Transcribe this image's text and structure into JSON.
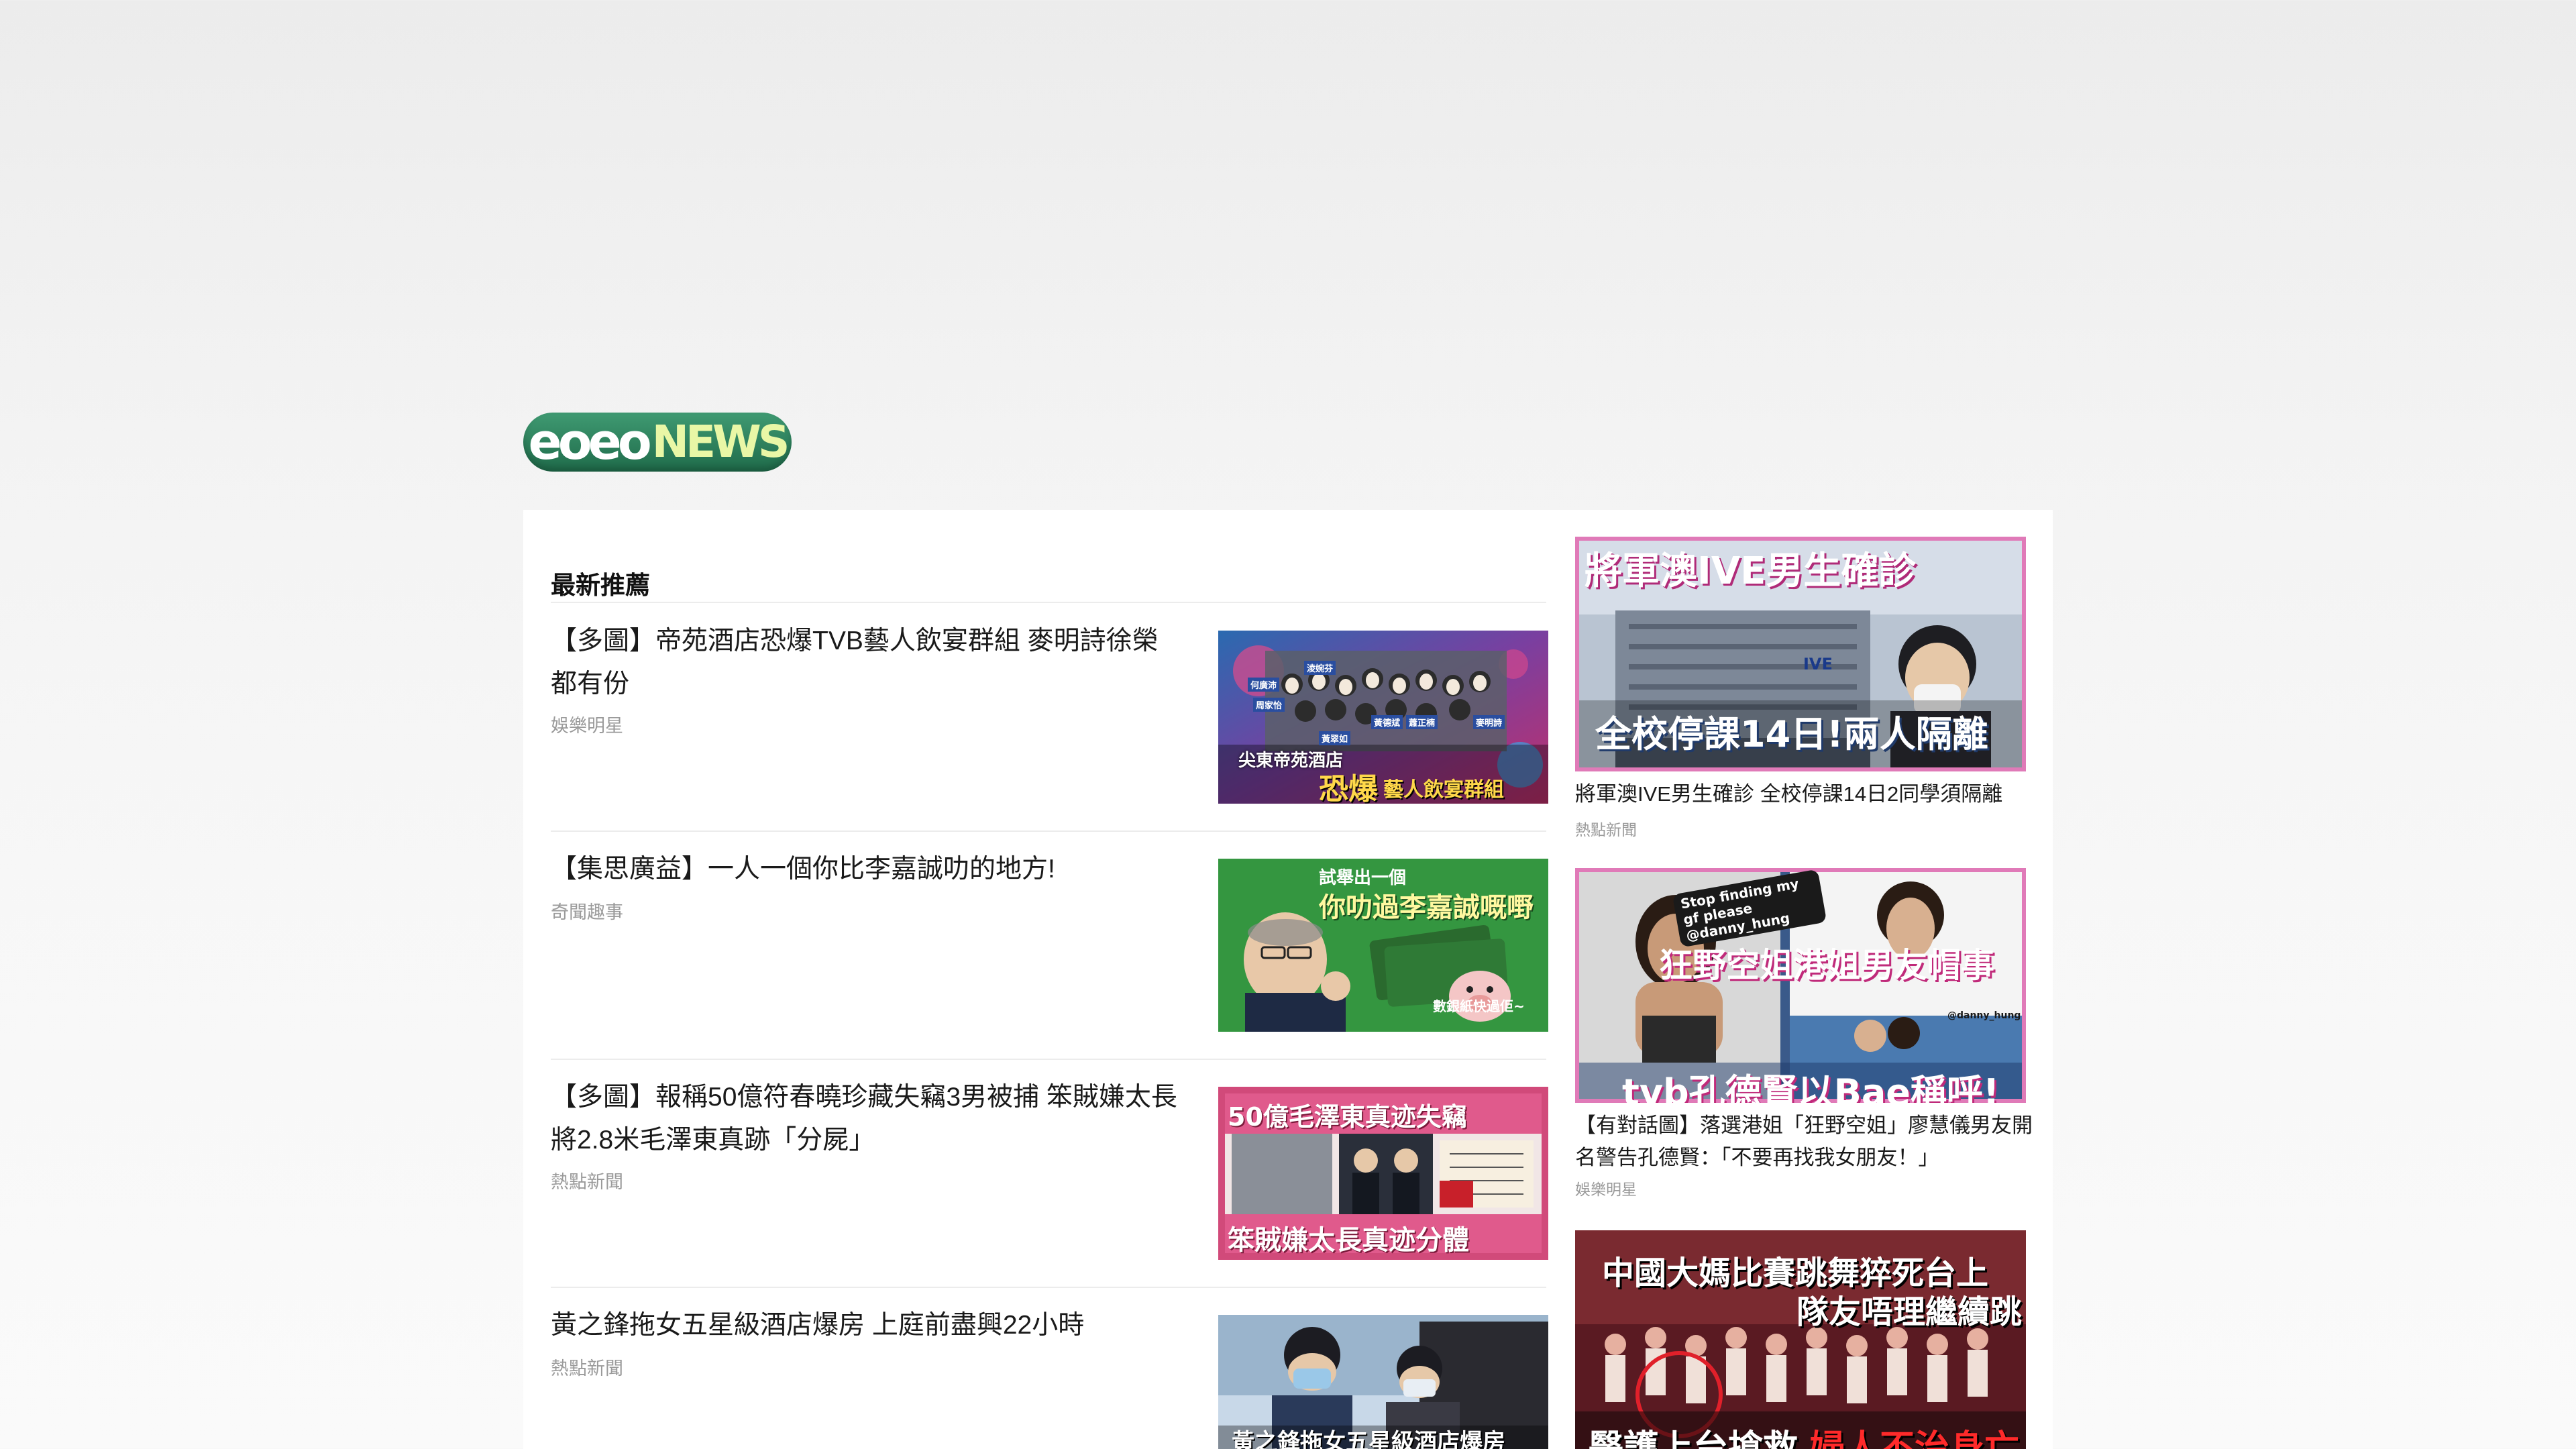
{
  "site": {
    "logo_part1": "eoeo",
    "logo_part2": "NEWS",
    "brand_green": "#2e7d5b",
    "brand_yellow": "#e9f7a6"
  },
  "main": {
    "section_title": "最新推薦",
    "articles": [
      {
        "title": "【多圖】帝苑酒店恐爆TVB藝人飲宴群組 麥明詩徐榮都有份",
        "category": "娛樂明星",
        "thumb_caption_small": "尖東帝苑酒店",
        "thumb_caption_big": "恐爆",
        "thumb_caption_tail": "藝人飲宴群組",
        "thumb_name_tags": [
          "淩婉芬",
          "何廣沛",
          "周家怡",
          "黃德斌",
          "麥明詩",
          "蕭正楠",
          "黃翠如"
        ],
        "icon": "news-photo-thumbnail"
      },
      {
        "title": "【集思廣益】一人一個你比李嘉誠叻的地方!",
        "category": "奇聞趣事",
        "thumb_caption_top": "試舉出一個",
        "thumb_caption_main": "你叻過李嘉誠嘅嘢",
        "thumb_caption_bottom": "數銀紙快過佢~",
        "icon": "news-photo-thumbnail"
      },
      {
        "title": "【多圖】報稱50億符春曉珍藏失竊3男被捕 笨賊嫌太長 將2.8米毛澤東真跡「分屍」",
        "category": "熱點新聞",
        "thumb_caption_top": "50億毛澤東真迹失竊",
        "thumb_caption_bottom": "笨賊嫌太長真迹分體",
        "icon": "news-photo-thumbnail"
      },
      {
        "title": "黃之鋒拖女五星級酒店爆房 上庭前盡興22小時",
        "category": "熱點新聞",
        "thumb_caption_bottom": "黃之鋒拖女五星級酒店爆房",
        "icon": "news-photo-thumbnail"
      }
    ]
  },
  "sidebar": {
    "cards": [
      {
        "title": "將軍澳IVE男生確診 全校停課14日2同學須隔離",
        "category": "熱點新聞",
        "thumb_caption_top": "將軍澳IVE男生確診",
        "thumb_caption_bottom": "全校停課14日!兩人隔離",
        "thumb_sign": "IVE",
        "border_color": "#e07ab8"
      },
      {
        "title": "【有對話圖】落選港姐「狂野空姐」廖慧儀男友開名警告孔德賢：「不要再找我女朋友！」",
        "category": "娛樂明星",
        "thumb_caption_main": "狂野空姐港姐男友帽事",
        "thumb_caption_bottom": "tvb孔德賢以Bae稱呼!",
        "thumb_chat_bubble": "Stop finding my gf please @danny_hung",
        "thumb_handle": "@danny_hung",
        "border_color": "#e07ab8"
      },
      {
        "title": "",
        "category": "",
        "thumb_caption_top1": "中國大媽比賽跳舞猝死台上",
        "thumb_caption_top2": "隊友唔理繼續跳",
        "thumb_caption_bottom_white": "醫護上台搶救",
        "thumb_caption_bottom_red": "婦人不治身亡"
      }
    ]
  }
}
